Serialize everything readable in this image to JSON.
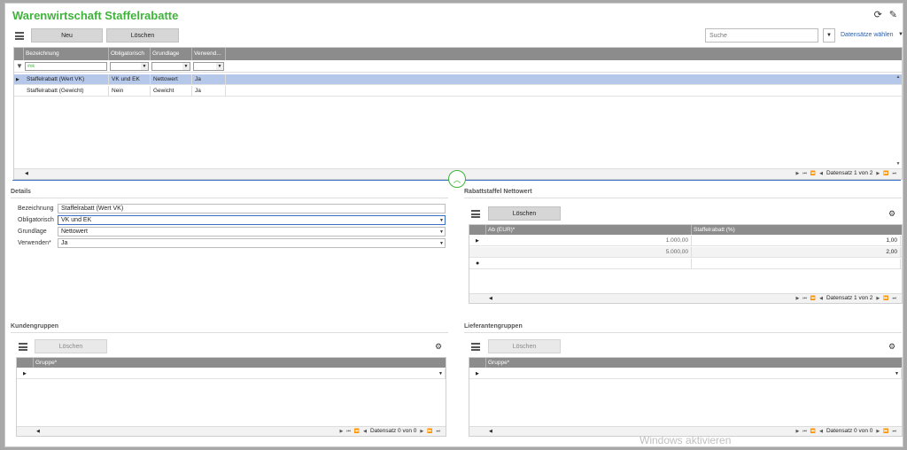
{
  "window": {
    "title": "Warenwirtschaft Staffelrabatte"
  },
  "toolbar": {
    "new_label": "Neu",
    "delete_label": "Löschen",
    "search_placeholder": "Suche",
    "datasets_label": "Datensätze wählen"
  },
  "main_grid": {
    "columns": [
      "Bezeichnung",
      "Obligatorisch",
      "Grundlage",
      "Verwend..."
    ],
    "filter_text": "#ok",
    "rows": [
      [
        "Staffelrabatt (Wert VK)",
        "VK und EK",
        "Nettowert",
        "Ja"
      ],
      [
        "Staffelrabatt (Gewicht)",
        "Nein",
        "Gewicht",
        "Ja"
      ]
    ],
    "pager": "Datensatz 1 von 2"
  },
  "details": {
    "title": "Details",
    "fields": [
      {
        "label": "Bezeichnung",
        "value": "Staffelrabatt (Wert VK)"
      },
      {
        "label": "Obligatorisch",
        "value": "VK und EK"
      },
      {
        "label": "Grundlage",
        "value": "Nettowert"
      },
      {
        "label": "Verwenden*",
        "value": "Ja"
      }
    ]
  },
  "rabatt": {
    "title": "Rabattstaffel Nettowert",
    "delete_label": "Löschen",
    "columns": [
      "Ab (EUR)*",
      "Staffelrabatt (%)"
    ],
    "rows": [
      [
        "1.000,00",
        "1,00"
      ],
      [
        "5.000,00",
        "2,00"
      ]
    ],
    "pager": "Datensatz 1 von 2"
  },
  "kunden": {
    "title": "Kundengruppen",
    "delete_label": "Löschen",
    "column": "Gruppe*",
    "pager": "Datensatz 0 von 0"
  },
  "lieferanten": {
    "title": "Lieferantengruppen",
    "delete_label": "Löschen",
    "column": "Gruppe*",
    "pager": "Datensatz 0 von 0"
  },
  "watermark": "Windows aktivieren"
}
